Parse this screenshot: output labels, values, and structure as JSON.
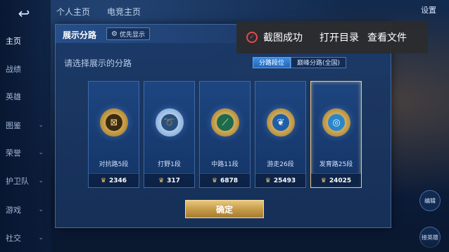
{
  "nav": {
    "back": "↩",
    "items": [
      {
        "label": "主页",
        "chev": ""
      },
      {
        "label": "战绩",
        "chev": ""
      },
      {
        "label": "英雄",
        "chev": ""
      },
      {
        "label": "图鉴",
        "chev": "⌄"
      },
      {
        "label": "荣誉",
        "chev": "⌄"
      },
      {
        "label": "护卫队",
        "chev": "⌄"
      },
      {
        "label": "游戏",
        "chev": "⌄"
      },
      {
        "label": "社交",
        "chev": "⌄"
      }
    ]
  },
  "top_tabs": [
    "个人主页",
    "电竞主页"
  ],
  "top_right": {
    "setting": "设置"
  },
  "dialog": {
    "title": "展示分路",
    "priority_label": "优先显示",
    "prompt": "请选择展示的分路",
    "seg_tabs": [
      {
        "label": "分路段位",
        "active": true
      },
      {
        "label": "巅峰分路(全国)",
        "active": false
      }
    ],
    "cards": [
      {
        "label": "对抗路5段",
        "score": "2346",
        "icon": "shield-badge-icon",
        "glyph": "⊠",
        "style": "gold",
        "selected": false
      },
      {
        "label": "打野1段",
        "score": "317",
        "icon": "swirl-badge-icon",
        "glyph": "➰",
        "style": "silver",
        "selected": false
      },
      {
        "label": "中路11段",
        "score": "6878",
        "icon": "diagonal-badge-icon",
        "glyph": "⟋",
        "style": "green",
        "selected": false
      },
      {
        "label": "游走26段",
        "score": "25493",
        "icon": "wings-badge-icon",
        "glyph": "❦",
        "style": "blue",
        "selected": false
      },
      {
        "label": "发育路25段",
        "score": "24025",
        "icon": "target-badge-icon",
        "glyph": "◎",
        "style": "cyan",
        "selected": true
      }
    ],
    "confirm_label": "确定"
  },
  "toast": {
    "message": "截图成功",
    "open_dir": "打开目录",
    "view_file": "查看文件"
  },
  "side": {
    "bottom_right_label": "接英雄",
    "mid_right_label": "编辑"
  }
}
